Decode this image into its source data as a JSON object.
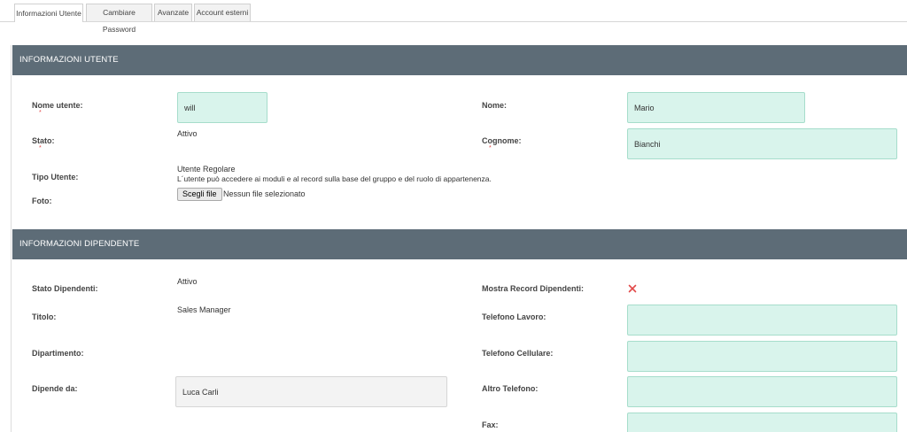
{
  "tabs": [
    {
      "label": "Informazioni Utente"
    },
    {
      "label": "Cambiare Password"
    },
    {
      "label": "Avanzate"
    },
    {
      "label": "Account esterni"
    }
  ],
  "user_info": {
    "header": "INFORMAZIONI UTENTE",
    "username_label": "Nome utente:",
    "username_value": "will",
    "first_name_label": "Nome:",
    "first_name_value": "Mario",
    "status_label": "Stato:",
    "status_value": "Attivo",
    "last_name_label": "Cognome:",
    "last_name_value": "Bianchi",
    "user_type_label": "Tipo Utente:",
    "user_type_value": "Utente Regolare",
    "user_type_desc": "L´utente può accedere ai moduli e al record sulla base del gruppo e del ruolo di appartenenza.",
    "photo_label": "Foto:",
    "file_button": "Scegli file",
    "file_status": "Nessun file selezionato"
  },
  "employee_info": {
    "header": "INFORMAZIONI DIPENDENTE",
    "employee_status_label": "Stato Dipendenti:",
    "employee_status_value": "Attivo",
    "show_records_label": "Mostra Record Dipendenti:",
    "title_label": "Titolo:",
    "title_value": "Sales Manager",
    "work_phone_label": "Telefono Lavoro:",
    "work_phone_value": "",
    "department_label": "Dipartimento:",
    "mobile_phone_label": "Telefono Cellulare:",
    "mobile_phone_value": "",
    "reports_to_label": "Dipende da:",
    "reports_to_value": "Luca Carli",
    "other_phone_label": "Altro Telefono:",
    "other_phone_value": "",
    "fax_label": "Fax:",
    "fax_value": ""
  },
  "colors": {
    "header_bg": "#5d6c77",
    "field_bg": "#d9f4ec",
    "required": "#e24a4a"
  }
}
